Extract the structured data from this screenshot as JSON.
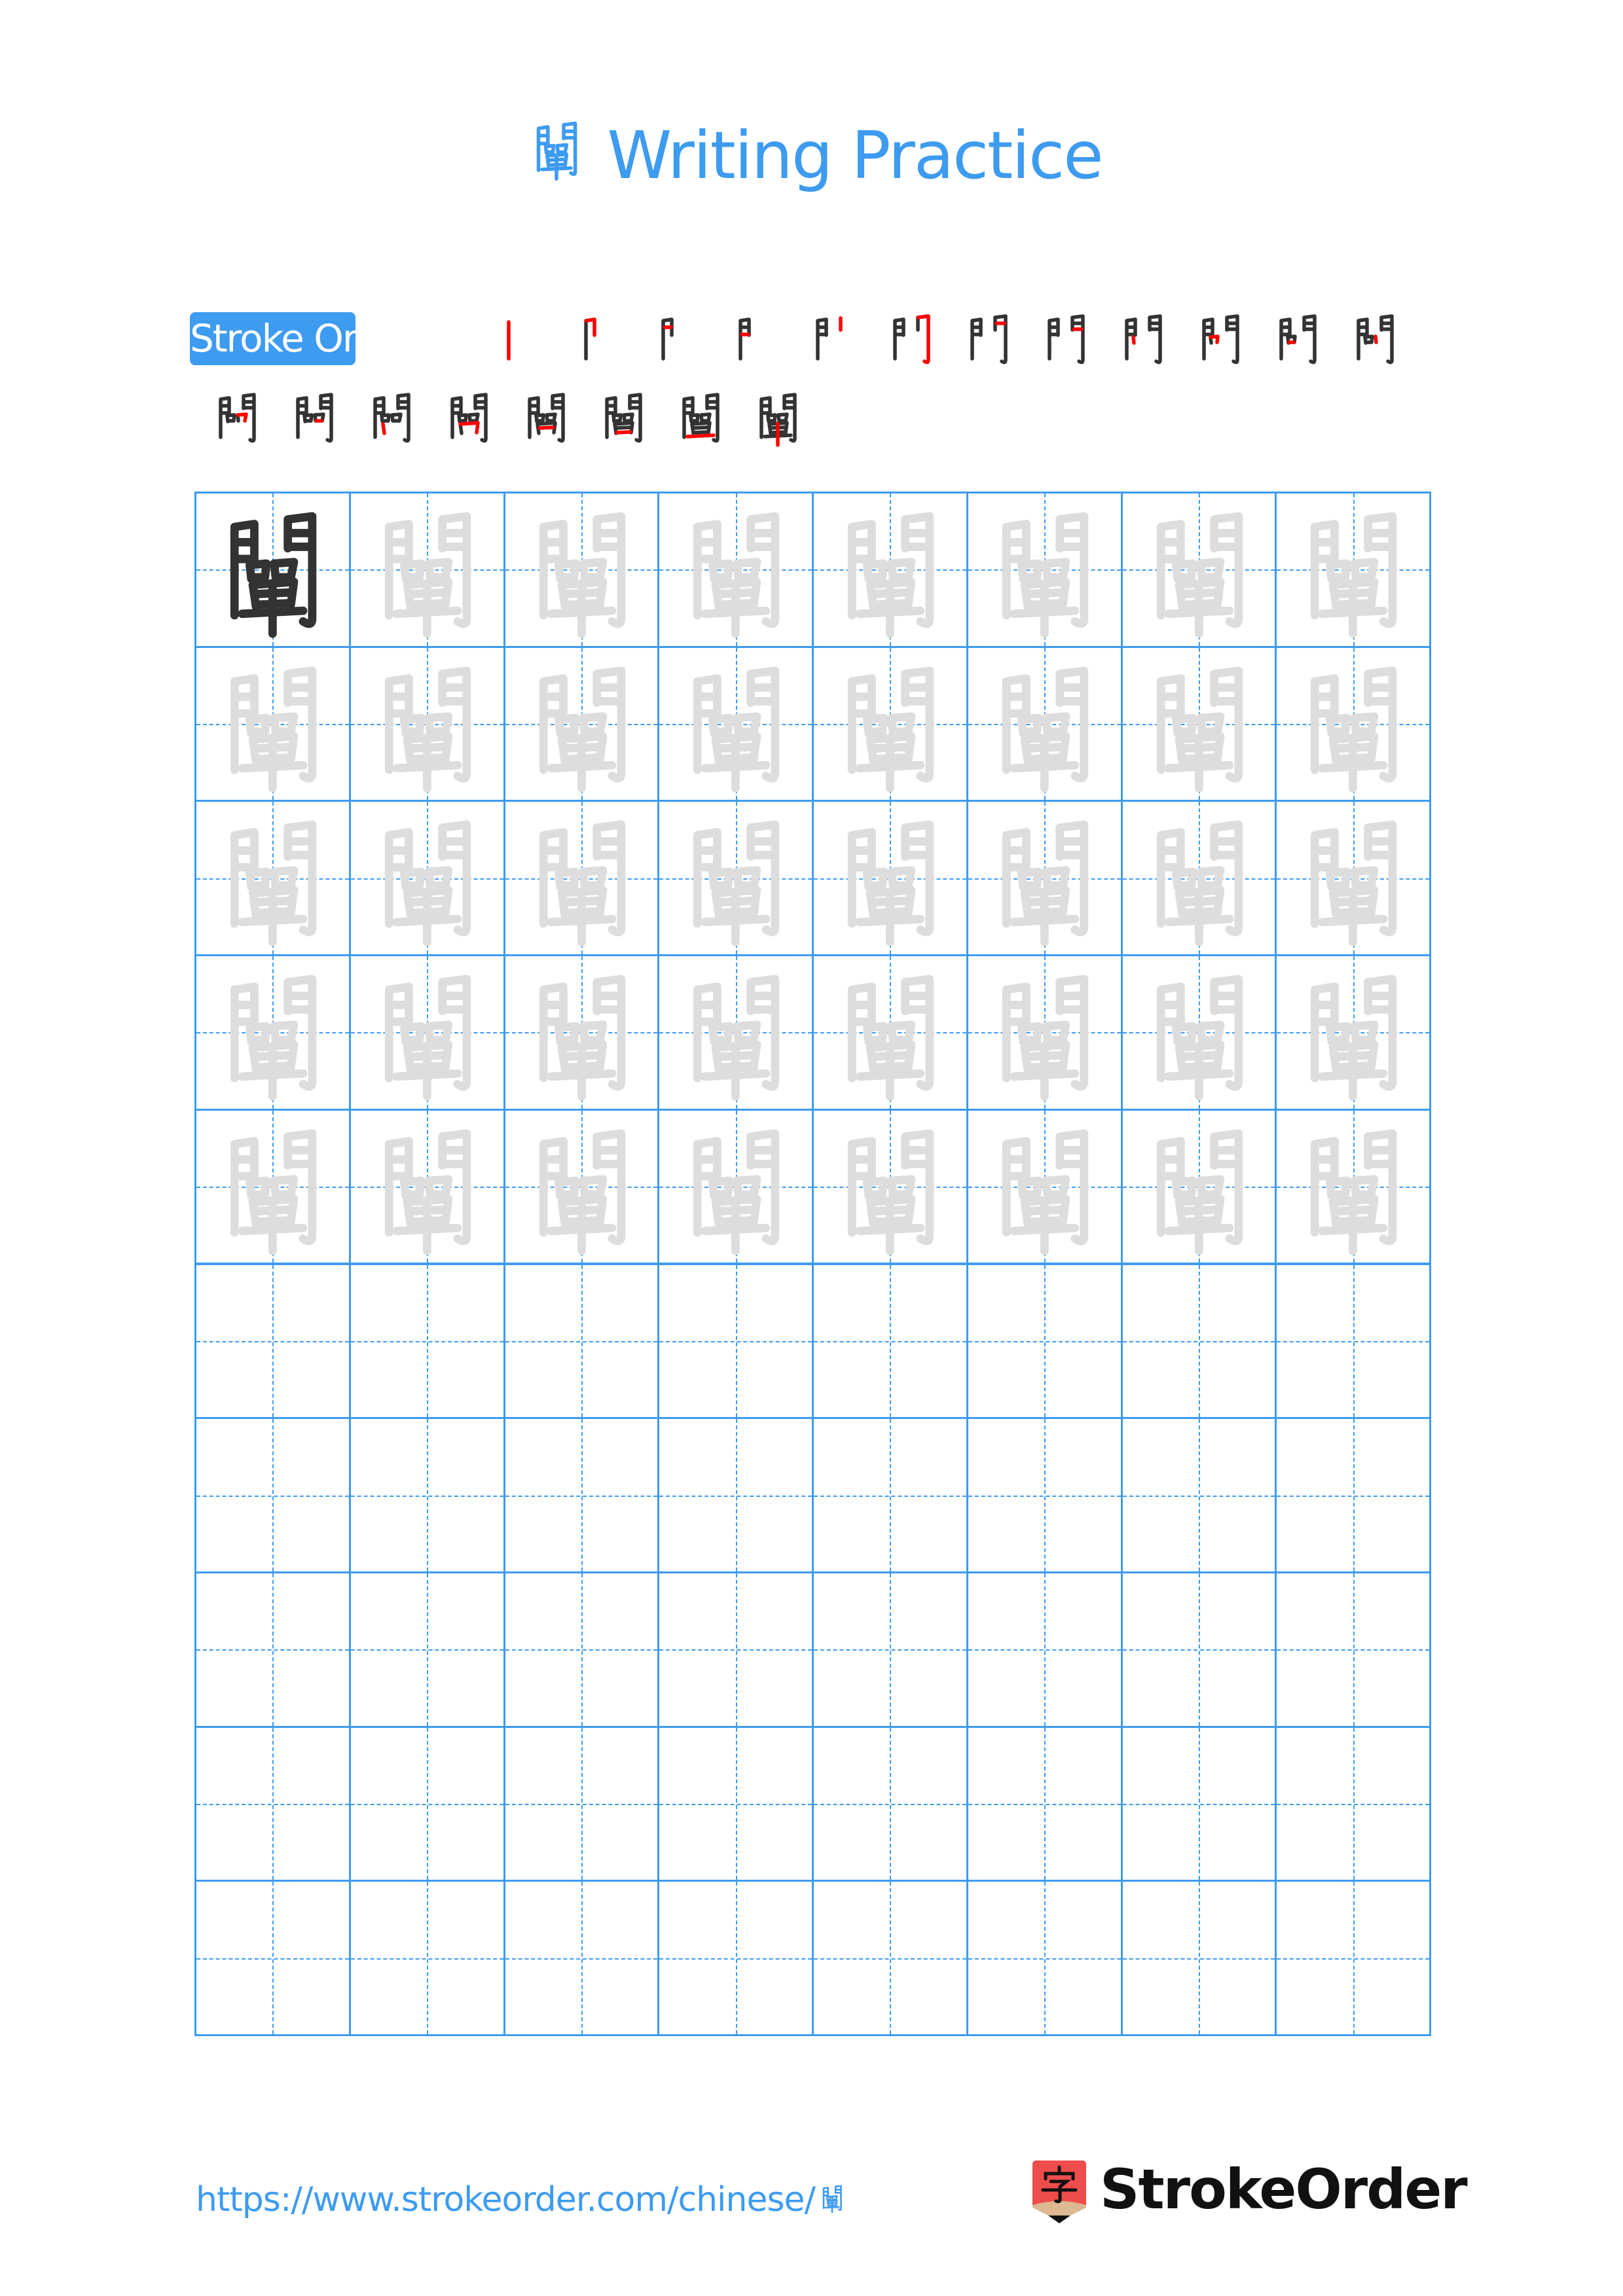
{
  "page": {
    "character": "闡",
    "title_char": "闡",
    "title_text": "Writing Practice",
    "stroke_order_label": "Stroke Order",
    "stroke_count": 20,
    "footer_url_prefix": "https://www.strokeorder.com/chinese/",
    "footer_url_char": "闡",
    "brand_name": "StrokeOrder",
    "logo_glyph": "字"
  },
  "colors": {
    "accent": "#3d9bf0",
    "model_char": "#333333",
    "trace_char": "#dddddd",
    "new_stroke": "#ff0000",
    "logo_red": "#ef4c4c",
    "logo_wood": "#dcb893",
    "brand_text": "#111111"
  },
  "stroke_steps": [
    {
      "step": 1,
      "row": 1
    },
    {
      "step": 2,
      "row": 1
    },
    {
      "step": 3,
      "row": 1
    },
    {
      "step": 4,
      "row": 1
    },
    {
      "step": 5,
      "row": 1
    },
    {
      "step": 6,
      "row": 1
    },
    {
      "step": 7,
      "row": 1
    },
    {
      "step": 8,
      "row": 1
    },
    {
      "step": 9,
      "row": 1
    },
    {
      "step": 10,
      "row": 1
    },
    {
      "step": 11,
      "row": 1
    },
    {
      "step": 12,
      "row": 1
    },
    {
      "step": 13,
      "row": 2
    },
    {
      "step": 14,
      "row": 2
    },
    {
      "step": 15,
      "row": 2
    },
    {
      "step": 16,
      "row": 2
    },
    {
      "step": 17,
      "row": 2
    },
    {
      "step": 18,
      "row": 2
    },
    {
      "step": 19,
      "row": 2
    },
    {
      "step": 20,
      "row": 2
    }
  ],
  "practice_grid": {
    "columns": 8,
    "rows": 10,
    "rows_with_trace": 5,
    "model_cells": 1,
    "empty_rows": 5
  }
}
